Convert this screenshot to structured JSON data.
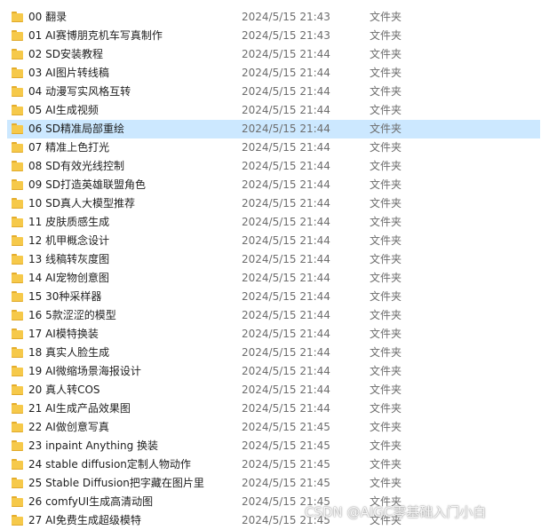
{
  "columns": {
    "type_label": "文件夹"
  },
  "selected_index": 6,
  "files": [
    {
      "name": "00 翻录",
      "date": "2024/5/15 21:43",
      "type": "文件夹"
    },
    {
      "name": "01 AI赛博朋克机车写真制作",
      "date": "2024/5/15 21:43",
      "type": "文件夹"
    },
    {
      "name": "02 SD安装教程",
      "date": "2024/5/15 21:44",
      "type": "文件夹"
    },
    {
      "name": "03 AI图片转线稿",
      "date": "2024/5/15 21:44",
      "type": "文件夹"
    },
    {
      "name": "04 动漫写实风格互转",
      "date": "2024/5/15 21:44",
      "type": "文件夹"
    },
    {
      "name": "05 AI生成视频",
      "date": "2024/5/15 21:44",
      "type": "文件夹"
    },
    {
      "name": "06 SD精准局部重绘",
      "date": "2024/5/15 21:44",
      "type": "文件夹"
    },
    {
      "name": "07 精准上色打光",
      "date": "2024/5/15 21:44",
      "type": "文件夹"
    },
    {
      "name": "08 SD有效光线控制",
      "date": "2024/5/15 21:44",
      "type": "文件夹"
    },
    {
      "name": "09 SD打造英雄联盟角色",
      "date": "2024/5/15 21:44",
      "type": "文件夹"
    },
    {
      "name": "10 SD真人大模型推荐",
      "date": "2024/5/15 21:44",
      "type": "文件夹"
    },
    {
      "name": "11 皮肤质感生成",
      "date": "2024/5/15 21:44",
      "type": "文件夹"
    },
    {
      "name": "12 机甲概念设计",
      "date": "2024/5/15 21:44",
      "type": "文件夹"
    },
    {
      "name": "13 线稿转灰度图",
      "date": "2024/5/15 21:44",
      "type": "文件夹"
    },
    {
      "name": "14 AI宠物创意图",
      "date": "2024/5/15 21:44",
      "type": "文件夹"
    },
    {
      "name": "15 30种采样器",
      "date": "2024/5/15 21:44",
      "type": "文件夹"
    },
    {
      "name": "16 5款涩涩的模型",
      "date": "2024/5/15 21:44",
      "type": "文件夹"
    },
    {
      "name": "17 AI模特换装",
      "date": "2024/5/15 21:44",
      "type": "文件夹"
    },
    {
      "name": "18 真实人脸生成",
      "date": "2024/5/15 21:44",
      "type": "文件夹"
    },
    {
      "name": "19 AI微缩场景海报设计",
      "date": "2024/5/15 21:44",
      "type": "文件夹"
    },
    {
      "name": "20 真人转COS",
      "date": "2024/5/15 21:44",
      "type": "文件夹"
    },
    {
      "name": "21 AI生成产品效果图",
      "date": "2024/5/15 21:44",
      "type": "文件夹"
    },
    {
      "name": "22 AI做创意写真",
      "date": "2024/5/15 21:45",
      "type": "文件夹"
    },
    {
      "name": "23 inpaint Anything 换装",
      "date": "2024/5/15 21:45",
      "type": "文件夹"
    },
    {
      "name": "24 stable diffusion定制人物动作",
      "date": "2024/5/15 21:45",
      "type": "文件夹"
    },
    {
      "name": "25 Stable Diffusion把字藏在图片里",
      "date": "2024/5/15 21:45",
      "type": "文件夹"
    },
    {
      "name": "26 comfyUI生成高清动图",
      "date": "2024/5/15 21:45",
      "type": "文件夹"
    },
    {
      "name": "27 AI免费生成超级模特",
      "date": "2024/5/15 21:45",
      "type": "文件夹"
    }
  ],
  "watermark": "CSDN @AIGC零基础入门小白",
  "colors": {
    "selection": "#cce8ff",
    "folder": "#f6c94a",
    "secondary_text": "#6d6d6d"
  },
  "icons": {
    "row_icon": "folder-icon"
  }
}
